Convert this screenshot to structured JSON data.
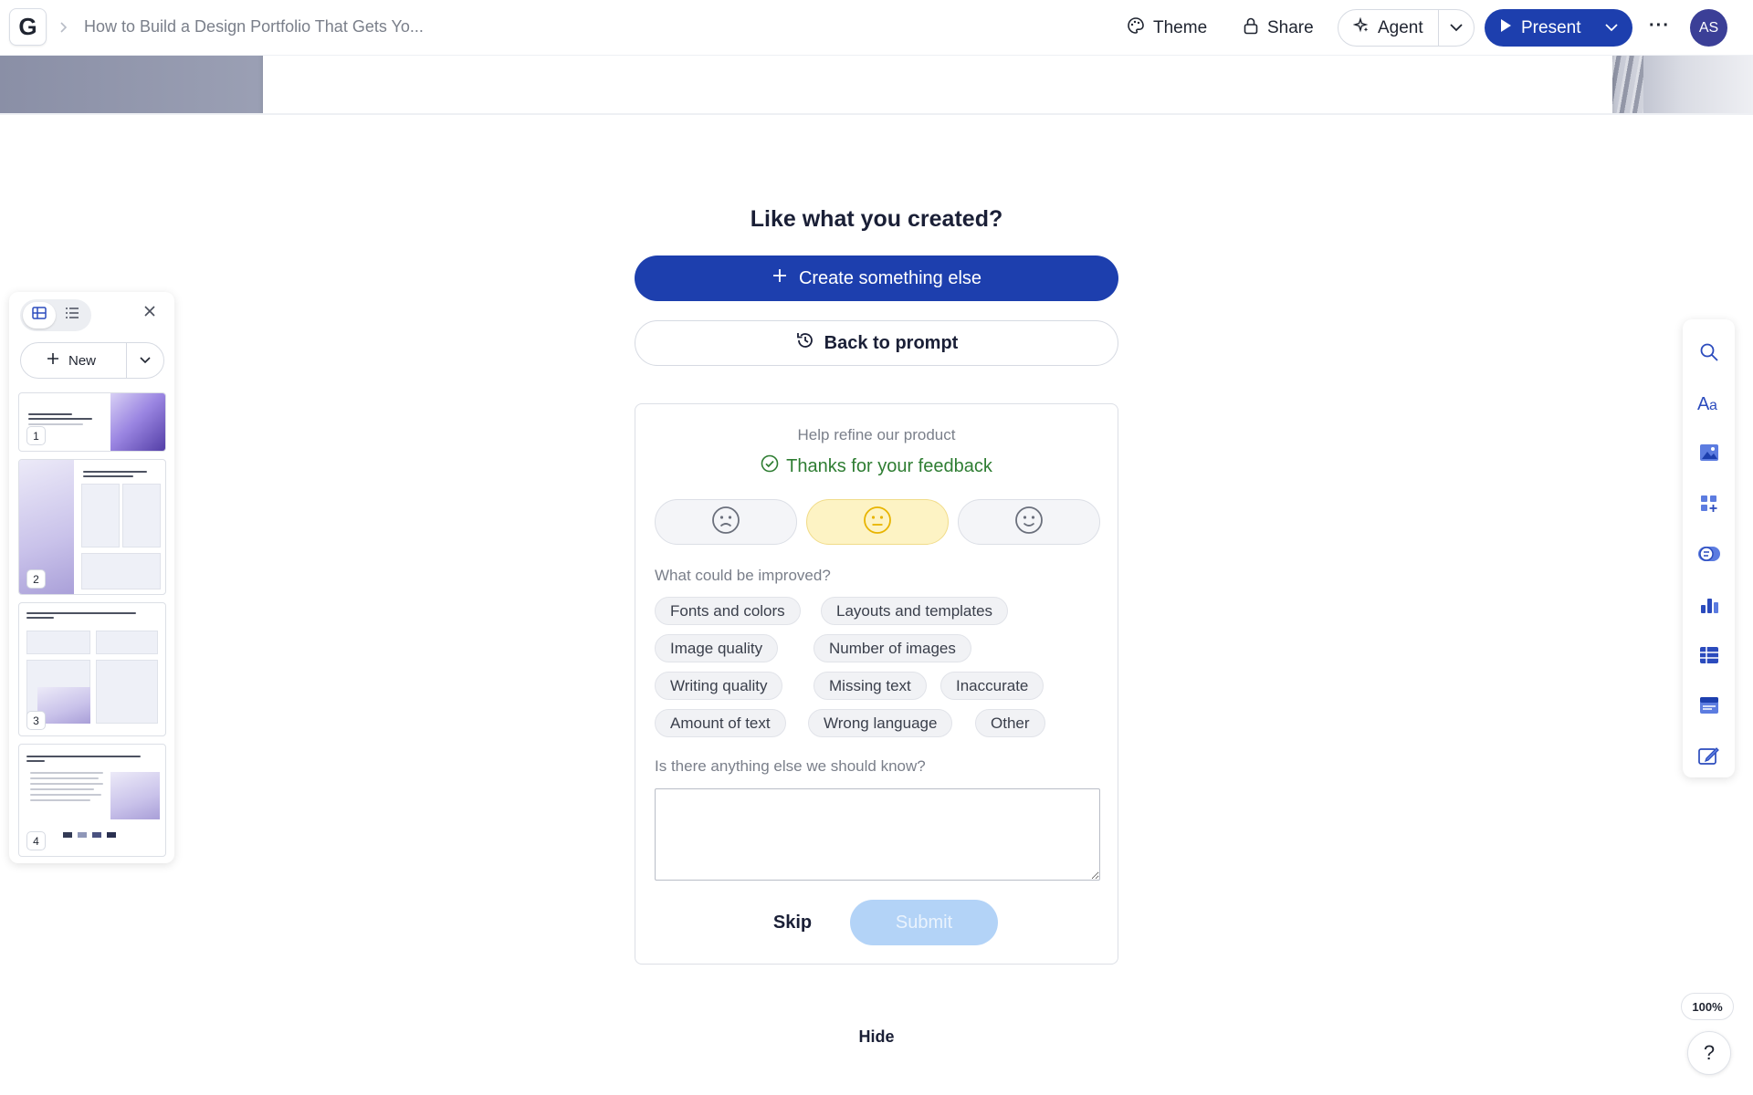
{
  "topbar": {
    "logo_letter": "G",
    "doc_title": "How to Build a Design Portfolio That Gets Yo...",
    "theme_label": "Theme",
    "share_label": "Share",
    "agent_label": "Agent",
    "present_label": "Present",
    "avatar_initials": "AS"
  },
  "slides_panel": {
    "new_label": "New",
    "thumbnails": [
      {
        "number": "1",
        "title": "Building a Design Portfolio That Gets You"
      },
      {
        "number": "2",
        "title": "Why Your Portfolio Matters More Than Your Resume"
      },
      {
        "number": "3",
        "title": "What to Include: The Essential Portfolio Sections"
      },
      {
        "number": "4",
        "title": "Choosing the Right Platform and Keeping It Fresh"
      }
    ]
  },
  "feedback": {
    "headline": "Like what you created?",
    "create_label": "Create something else",
    "back_label": "Back to prompt",
    "subtitle": "Help refine our product",
    "thanks": "Thanks for your feedback",
    "ratings": [
      {
        "name": "sad-face-icon",
        "selected": false
      },
      {
        "name": "neutral-face-icon",
        "selected": true
      },
      {
        "name": "happy-face-icon",
        "selected": false
      }
    ],
    "question_improve": "What could be improved?",
    "chips": [
      "Fonts and colors",
      "Layouts and templates",
      "Image quality",
      "Number of images",
      "Writing quality",
      "Missing text",
      "Inaccurate",
      "Amount of text",
      "Wrong language",
      "Other"
    ],
    "question_more": "Is there anything else we should know?",
    "textarea_value": "",
    "skip_label": "Skip",
    "submit_label": "Submit"
  },
  "hide_label": "Hide",
  "zoom": "100%",
  "help_label": "?",
  "tools": [
    "search-icon",
    "text-style-icon",
    "image-icon",
    "add-block-icon",
    "toggle-icon",
    "chart-icon",
    "table-icon",
    "layout-icon",
    "edit-icon"
  ],
  "colors": {
    "accent": "#1d3fae",
    "selected_rating": "#fdf3c4",
    "thanks_green": "#2e7d32",
    "submit_disabled": "#b3d3f7"
  }
}
